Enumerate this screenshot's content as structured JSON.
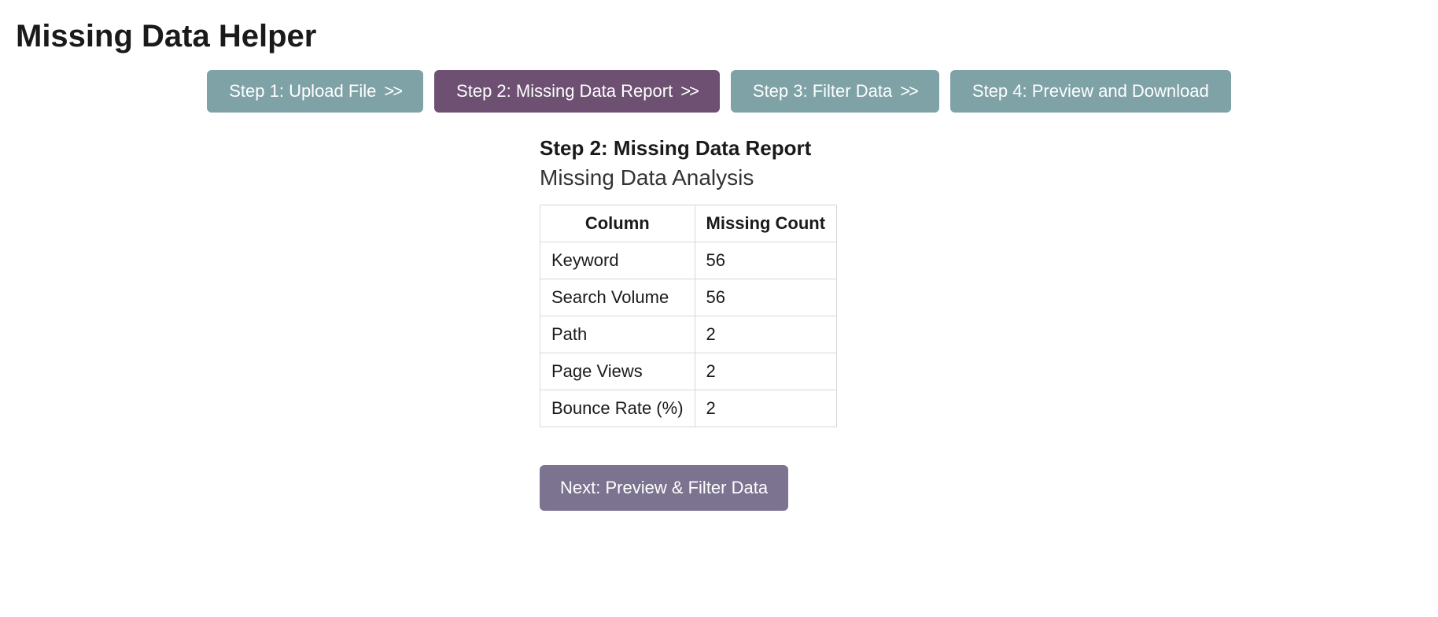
{
  "page_title": "Missing Data Helper",
  "steps": [
    {
      "label": "Step 1: Upload File",
      "chevrons": ">>",
      "active": false
    },
    {
      "label": "Step 2: Missing Data Report",
      "chevrons": ">>",
      "active": true
    },
    {
      "label": "Step 3: Filter Data",
      "chevrons": ">>",
      "active": false
    },
    {
      "label": "Step 4: Preview and Download",
      "chevrons": "",
      "active": false
    }
  ],
  "content": {
    "step_heading": "Step 2: Missing Data Report",
    "analysis_heading": "Missing Data Analysis",
    "table": {
      "headers": [
        "Column",
        "Missing Count"
      ],
      "rows": [
        {
          "column": "Keyword",
          "missing_count": "56"
        },
        {
          "column": "Search Volume",
          "missing_count": "56"
        },
        {
          "column": "Path",
          "missing_count": "2"
        },
        {
          "column": "Page Views",
          "missing_count": "2"
        },
        {
          "column": "Bounce Rate (%)",
          "missing_count": "2"
        }
      ]
    },
    "next_button_label": "Next: Preview & Filter Data"
  }
}
